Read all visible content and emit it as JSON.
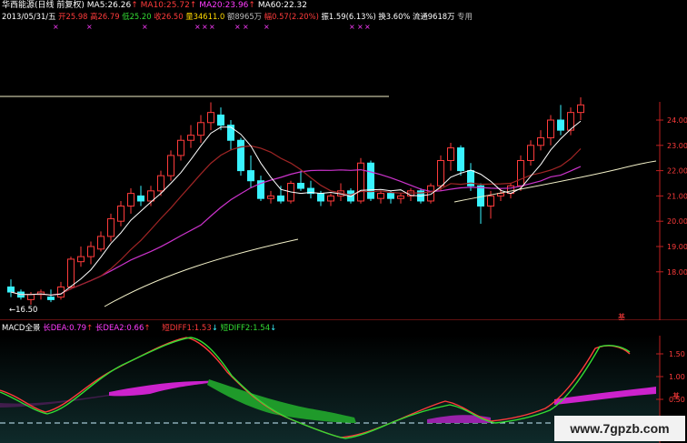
{
  "header": {
    "title": "华西能源(日线 前复权)",
    "ma5_label": "MA5:",
    "ma5": "26.26",
    "ma10_label": "MA10:",
    "ma10": "25.72",
    "ma20_label": "MA20:",
    "ma20": "23.96",
    "ma60_label": "MA60:",
    "ma60": "22.32",
    "date": "2013/05/31/五",
    "open_label": "开",
    "open": "25.98",
    "high_label": "高",
    "high": "26.79",
    "low_label": "低",
    "low": "25.20",
    "close_label": "收",
    "close": "26.50",
    "vol_label": "量",
    "vol": "34611.0",
    "amount_label": "额",
    "amount": "8965万",
    "change_label": "幅",
    "change": "0.57(2.20%)",
    "amp_label": "振",
    "amp": "1.59(6.13%)",
    "turnover_label": "换",
    "turnover": "3.60%",
    "float_label": "流通",
    "float": "9618万",
    "tail": "专用"
  },
  "price_axis": {
    "ticks": [
      "24.00",
      "23.00",
      "22.00",
      "21.00",
      "20.00",
      "19.00",
      "18.00"
    ],
    "bottom_mark": "基"
  },
  "low_marker": "←16.50",
  "macd": {
    "title": "MACD全景",
    "dea_label": "长DEA:",
    "dea": "0.79",
    "dea2_label": "长DEA2:",
    "dea2": "0.66",
    "diff1_label": "短DIFF1:",
    "diff1": "1.53",
    "diff2_label": "短DIFF2:",
    "diff2": "1.54",
    "ticks": [
      "1.50",
      "1.00",
      "0.50"
    ],
    "bottom_mark": "基"
  },
  "watermark": "www.7gpzb.com",
  "colors": {
    "up": "#ff3b3b",
    "down": "#39f3ff",
    "ma5": "#ffffff",
    "ma10": "#c0392b",
    "ma20": "#cc33cc",
    "ma60": "#f2f0c8",
    "diff": "#33dd33",
    "dea": "#ff3b3b"
  },
  "chart_data": {
    "type": "candlestick",
    "candles_ohlc": [
      [
        17.4,
        17.7,
        17.0,
        17.2
      ],
      [
        17.2,
        17.3,
        16.9,
        17.0
      ],
      [
        16.9,
        17.2,
        16.7,
        17.1
      ],
      [
        17.1,
        17.3,
        16.9,
        17.2
      ],
      [
        17.0,
        17.3,
        16.8,
        16.9
      ],
      [
        17.0,
        17.6,
        16.9,
        17.4
      ],
      [
        17.4,
        18.6,
        17.3,
        18.5
      ],
      [
        18.4,
        19.0,
        18.2,
        18.6
      ],
      [
        18.6,
        19.2,
        18.3,
        19.0
      ],
      [
        18.9,
        19.6,
        18.8,
        19.4
      ],
      [
        19.4,
        20.3,
        19.2,
        20.1
      ],
      [
        20.0,
        20.8,
        19.8,
        20.6
      ],
      [
        20.6,
        21.3,
        20.3,
        21.1
      ],
      [
        21.0,
        21.4,
        20.6,
        20.8
      ],
      [
        20.8,
        21.4,
        20.6,
        21.2
      ],
      [
        21.2,
        22.0,
        21.0,
        21.8
      ],
      [
        21.8,
        22.8,
        21.6,
        22.6
      ],
      [
        22.6,
        23.4,
        22.4,
        23.2
      ],
      [
        23.2,
        23.8,
        22.9,
        23.4
      ],
      [
        23.4,
        24.2,
        23.1,
        23.9
      ],
      [
        23.9,
        24.7,
        23.6,
        24.3
      ],
      [
        24.2,
        24.5,
        23.6,
        23.8
      ],
      [
        23.8,
        24.0,
        22.8,
        23.2
      ],
      [
        23.2,
        23.3,
        21.8,
        22.0
      ],
      [
        22.0,
        22.6,
        21.3,
        21.6
      ],
      [
        21.6,
        21.8,
        20.8,
        20.9
      ],
      [
        20.9,
        21.2,
        20.7,
        21.0
      ],
      [
        21.0,
        21.4,
        20.7,
        20.8
      ],
      [
        20.8,
        21.6,
        20.7,
        21.5
      ],
      [
        21.5,
        22.0,
        21.2,
        21.3
      ],
      [
        21.3,
        21.6,
        20.9,
        21.1
      ],
      [
        21.1,
        21.2,
        20.6,
        20.8
      ],
      [
        20.8,
        21.1,
        20.6,
        21.0
      ],
      [
        21.0,
        21.5,
        20.8,
        21.2
      ],
      [
        21.2,
        21.3,
        20.7,
        20.8
      ],
      [
        20.8,
        22.5,
        20.7,
        22.3
      ],
      [
        22.3,
        22.4,
        20.8,
        20.9
      ],
      [
        20.9,
        21.2,
        20.7,
        21.1
      ],
      [
        21.1,
        21.2,
        20.7,
        20.9
      ],
      [
        20.9,
        21.1,
        20.7,
        21.0
      ],
      [
        21.0,
        21.3,
        20.8,
        21.2
      ],
      [
        21.2,
        21.3,
        20.7,
        20.8
      ],
      [
        20.8,
        21.5,
        20.7,
        21.4
      ],
      [
        21.4,
        22.6,
        21.2,
        22.4
      ],
      [
        22.4,
        23.1,
        22.0,
        22.9
      ],
      [
        22.9,
        23.0,
        21.8,
        22.0
      ],
      [
        22.0,
        22.3,
        21.2,
        21.4
      ],
      [
        21.4,
        21.5,
        19.9,
        20.6
      ],
      [
        20.6,
        21.2,
        20.1,
        21.0
      ],
      [
        21.0,
        21.3,
        20.8,
        21.1
      ],
      [
        21.1,
        21.5,
        20.9,
        21.4
      ],
      [
        21.4,
        22.6,
        21.2,
        22.4
      ],
      [
        22.4,
        23.2,
        22.2,
        23.0
      ],
      [
        23.0,
        23.6,
        22.8,
        23.3
      ],
      [
        23.3,
        24.2,
        23.0,
        24.0
      ],
      [
        24.0,
        24.6,
        23.4,
        23.6
      ],
      [
        23.6,
        24.5,
        23.4,
        24.3
      ],
      [
        24.3,
        24.9,
        24.0,
        24.6
      ]
    ]
  }
}
